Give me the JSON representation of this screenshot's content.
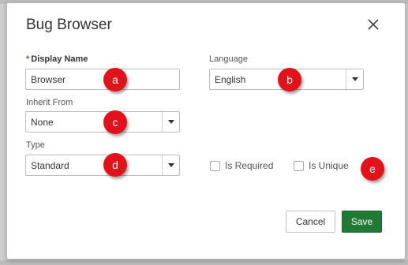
{
  "dialog": {
    "title": "Bug Browser"
  },
  "fields": {
    "display_name": {
      "required_mark": "*",
      "label": "Display Name",
      "value": "Browser"
    },
    "language": {
      "label": "Language",
      "value": "English"
    },
    "inherit_from": {
      "label": "Inherit From",
      "value": "None"
    },
    "type": {
      "label": "Type",
      "value": "Standard"
    },
    "is_required": {
      "label": "Is Required",
      "checked": false
    },
    "is_unique": {
      "label": "Is Unique",
      "checked": false
    }
  },
  "annotations": [
    "a",
    "b",
    "c",
    "d",
    "e"
  ],
  "buttons": {
    "cancel": "Cancel",
    "save": "Save"
  },
  "colors": {
    "badge": "#e3111a",
    "save_button": "#1f7a34",
    "required_mark": "#2e8b2e"
  }
}
